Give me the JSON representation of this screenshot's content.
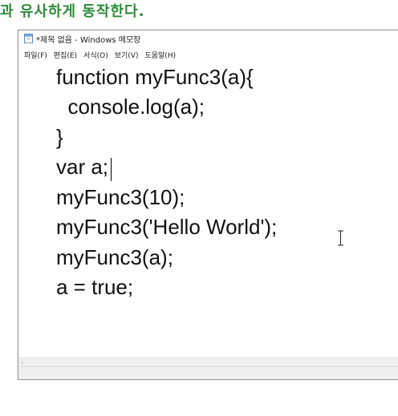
{
  "heading": "과 유사하게 동작한다.",
  "window": {
    "title": "*제목 없음 - Windows 메모장",
    "icon": "notepad-icon"
  },
  "menu": [
    {
      "label": "파일(F)"
    },
    {
      "label": "편집(E)"
    },
    {
      "label": "서식(O)"
    },
    {
      "label": "보기(V)"
    },
    {
      "label": "도움말(H)"
    }
  ],
  "editor": {
    "lines": [
      "function myFunc3(a){",
      "  console.log(a);",
      "}",
      "var a;",
      "myFunc3(10);",
      "myFunc3('Hello World');",
      "myFunc3(a);",
      "a = true;"
    ]
  },
  "scrollbar": {
    "left_arrow": "‹"
  },
  "colors": {
    "heading": "#2e8b3a",
    "text": "#111111",
    "chrome": "#f0f0f0"
  }
}
